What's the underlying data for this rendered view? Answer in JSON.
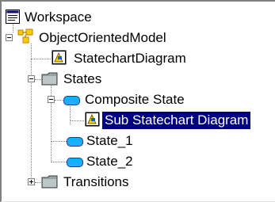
{
  "tree": {
    "root": {
      "label": "Workspace",
      "icon": "workspace-icon"
    },
    "items": [
      {
        "label": "ObjectOrientedModel",
        "icon": "model-icon",
        "expanded": true
      },
      {
        "label": "StatechartDiagram",
        "icon": "statechart-diagram-icon"
      },
      {
        "label": "States",
        "icon": "folder-icon",
        "expanded": true
      },
      {
        "label": "Composite State",
        "icon": "state-icon",
        "expanded": true
      },
      {
        "label": "Sub Statechart Diagram",
        "icon": "statechart-diagram-icon",
        "selected": true
      },
      {
        "label": "State_1",
        "icon": "state-icon"
      },
      {
        "label": "State_2",
        "icon": "state-icon"
      },
      {
        "label": "Transitions",
        "icon": "folder-icon",
        "expanded": false
      }
    ]
  },
  "colors": {
    "selection_bg": "#000080",
    "selection_text": "#ffffff",
    "connector": "#808080",
    "state_fill": "#00b7ff"
  }
}
